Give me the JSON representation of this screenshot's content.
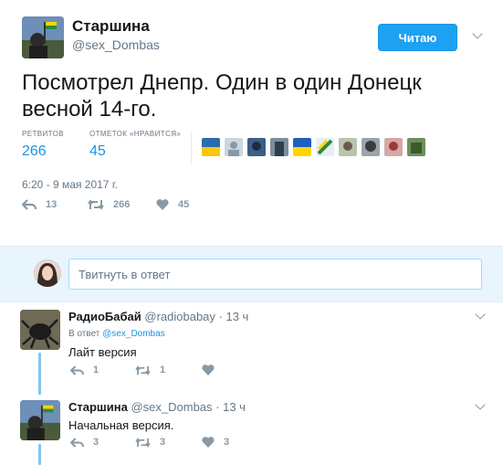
{
  "tweet": {
    "author_name": "Старшина",
    "author_handle": "@sex_Dombas",
    "follow_label": "Читаю",
    "text": "Посмотрел Днепр. Один в один Донецк весной 14-го.",
    "retweets_label": "РЕТВИТОВ",
    "retweets_count": "266",
    "likes_label": "ОТМЕТОК «НРАВИТСЯ»",
    "likes_count": "45",
    "date": "6:20 - 9 мая 2017 г.",
    "actions": {
      "reply": "13",
      "retweet": "266",
      "like": "45"
    }
  },
  "reply_box": {
    "placeholder": "Твитнуть в ответ"
  },
  "replies": [
    {
      "name": "РадиоБабай",
      "handle": "@radiobabay",
      "time": "· 13 ч",
      "in_reply_label": "В ответ",
      "in_reply_handle": "@sex_Dombas",
      "text": "Лайт версия",
      "actions": {
        "reply": "1",
        "retweet": "1",
        "like": ""
      }
    },
    {
      "name": "Старшина",
      "handle": "@sex_Dombas",
      "time": "· 13 ч",
      "text": "Начальная версия.",
      "actions": {
        "reply": "3",
        "retweet": "3",
        "like": "3"
      }
    }
  ],
  "colors": {
    "accent": "#1da1f2",
    "link": "#1b95e0",
    "muted": "#657786",
    "thread": "#83c5f3"
  }
}
